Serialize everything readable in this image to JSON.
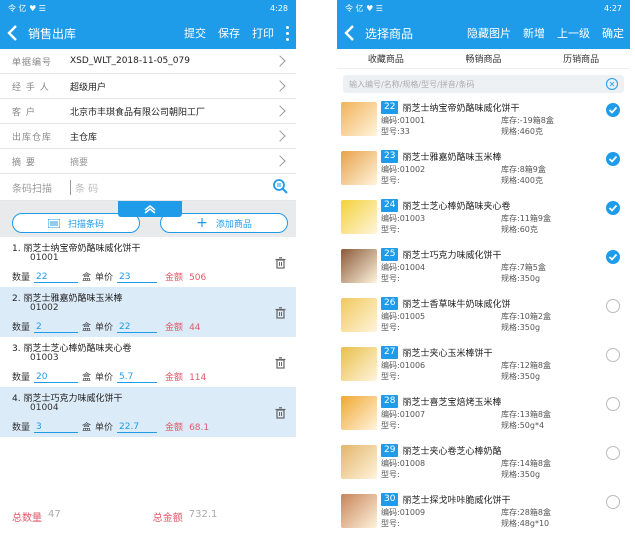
{
  "left": {
    "status": {
      "time": "4:28",
      "icons": "令 亿 ♥ ☰"
    },
    "nav": {
      "title": "销售出库",
      "actions": [
        "提交",
        "保存",
        "打印"
      ]
    },
    "form": [
      {
        "label": "单据编号",
        "value": "XSD_WLT_2018-11-05_079"
      },
      {
        "label": "经 手 人",
        "value": "超级用户"
      },
      {
        "label": "客   户",
        "value": "北京市丰琪食品有限公司朝阳工厂"
      },
      {
        "label": "出库仓库",
        "value": "主仓库"
      },
      {
        "label": "摘   要",
        "value": "摘要"
      }
    ],
    "scan": {
      "label": "条码扫描",
      "placeholder": "条 码"
    },
    "buttons": {
      "scan": "扫描条码",
      "add": "添加商品"
    },
    "items": [
      {
        "name": "1.  丽芝士纳宝帝奶酪味威化饼干",
        "code": "01001",
        "qty_label": "数量",
        "qty": "22",
        "unit": "盒",
        "price_label": "单价",
        "price": "23",
        "amt_label": "金额",
        "amt": "506"
      },
      {
        "name": "2.  丽芝士雅嘉奶酪味玉米棒",
        "code": "01002",
        "qty_label": "数量",
        "qty": "2",
        "unit": "盒",
        "price_label": "单价",
        "price": "22",
        "amt_label": "金额",
        "amt": "44"
      },
      {
        "name": "3.  丽芝士芝心棒奶酪味夹心卷",
        "code": "01003",
        "qty_label": "数量",
        "qty": "20",
        "unit": "盒",
        "price_label": "单价",
        "price": "5.7",
        "amt_label": "金额",
        "amt": "114"
      },
      {
        "name": "4.  丽芝士巧克力味威化饼干",
        "code": "01004",
        "qty_label": "数量",
        "qty": "3",
        "unit": "盒",
        "price_label": "单价",
        "price": "22.7",
        "amt_label": "金额",
        "amt": "68.1"
      }
    ],
    "totals": {
      "qty_label": "总数量",
      "qty": "47",
      "amt_label": "总金额",
      "amt": "732.1"
    }
  },
  "right": {
    "status": {
      "time": "4:27",
      "icons": "令 亿 ♥ ☰"
    },
    "nav": {
      "title": "选择商品",
      "actions": [
        "隐藏图片",
        "新增",
        "上一级",
        "确定"
      ]
    },
    "tabs": [
      "收藏商品",
      "畅销商品",
      "历销商品"
    ],
    "search_placeholder": "输入编号/名称/规格/型号/拼音/条码",
    "products": [
      {
        "no": "22",
        "name": "丽芝士纳宝帝奶酪味威化饼干",
        "code": "编码:01001",
        "stock": "库存:-19箱8盒",
        "model": "型号:33",
        "spec": "规格:460克",
        "checked": true,
        "color": "#f2b25a"
      },
      {
        "no": "23",
        "name": "丽芝士雅嘉奶酪味玉米棒",
        "code": "编码:01002",
        "stock": "库存:8箱9盒",
        "model": "型号:",
        "spec": "规格:400克",
        "checked": true,
        "color": "#e8a24a"
      },
      {
        "no": "24",
        "name": "丽芝士芝心棒奶酪味夹心卷",
        "code": "编码:01003",
        "stock": "库存:11箱9盒",
        "model": "型号:",
        "spec": "规格:60克",
        "checked": true,
        "color": "#f3d23a"
      },
      {
        "no": "25",
        "name": "丽芝士巧克力味威化饼干",
        "code": "编码:01004",
        "stock": "库存:7箱5盒",
        "model": "型号:",
        "spec": "规格:350g",
        "checked": true,
        "color": "#8a5a3a"
      },
      {
        "no": "26",
        "name": "丽芝士香草味牛奶味威化饼",
        "code": "编码:01005",
        "stock": "库存:10箱2盒",
        "model": "型号:",
        "spec": "规格:350g",
        "checked": false,
        "color": "#f0c95c"
      },
      {
        "no": "27",
        "name": "丽芝士夹心玉米棒饼干",
        "code": "编码:01006",
        "stock": "库存:12箱8盒",
        "model": "型号:",
        "spec": "规格:350g",
        "checked": false,
        "color": "#e9c04a"
      },
      {
        "no": "28",
        "name": "丽芝士喜芝宝焙烤玉米棒",
        "code": "编码:01007",
        "stock": "库存:13箱8盒",
        "model": "型号:",
        "spec": "规格:50g*4",
        "checked": false,
        "color": "#f0a832"
      },
      {
        "no": "29",
        "name": "丽芝士夹心卷芝心棒奶酪",
        "code": "编码:01008",
        "stock": "库存:14箱8盒",
        "model": "型号:",
        "spec": "规格:350g",
        "checked": false,
        "color": "#e3b56a"
      },
      {
        "no": "30",
        "name": "丽芝士探戈咔咔脆威化饼干",
        "code": "编码:01009",
        "stock": "库存:28箱8盒",
        "model": "型号:",
        "spec": "规格:48g*10",
        "checked": false,
        "color": "#c8845a"
      }
    ]
  }
}
